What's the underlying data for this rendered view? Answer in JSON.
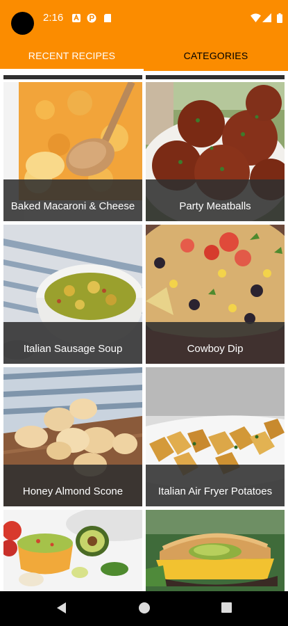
{
  "status_bar": {
    "time": "2:16",
    "left_icons": [
      "notification-a-icon",
      "app-p-icon",
      "sd-card-icon"
    ],
    "right_icons": [
      "wifi-icon",
      "cell-signal-icon",
      "battery-icon"
    ],
    "color": "#fb8c00"
  },
  "tabs": [
    {
      "label": "RECENT RECIPES",
      "active": true
    },
    {
      "label": "CATEGORIES",
      "active": false
    }
  ],
  "recipes": [
    {
      "title": "Baked Macaroni & Cheese"
    },
    {
      "title": "Party Meatballs"
    },
    {
      "title": "Italian Sausage Soup"
    },
    {
      "title": "Cowboy Dip"
    },
    {
      "title": "Honey Almond Scone"
    },
    {
      "title": "Italian Air Fryer Potatoes"
    },
    {
      "title": ""
    },
    {
      "title": ""
    }
  ],
  "nav_bar": {
    "buttons": [
      "back-icon",
      "home-icon",
      "recents-icon"
    ]
  }
}
